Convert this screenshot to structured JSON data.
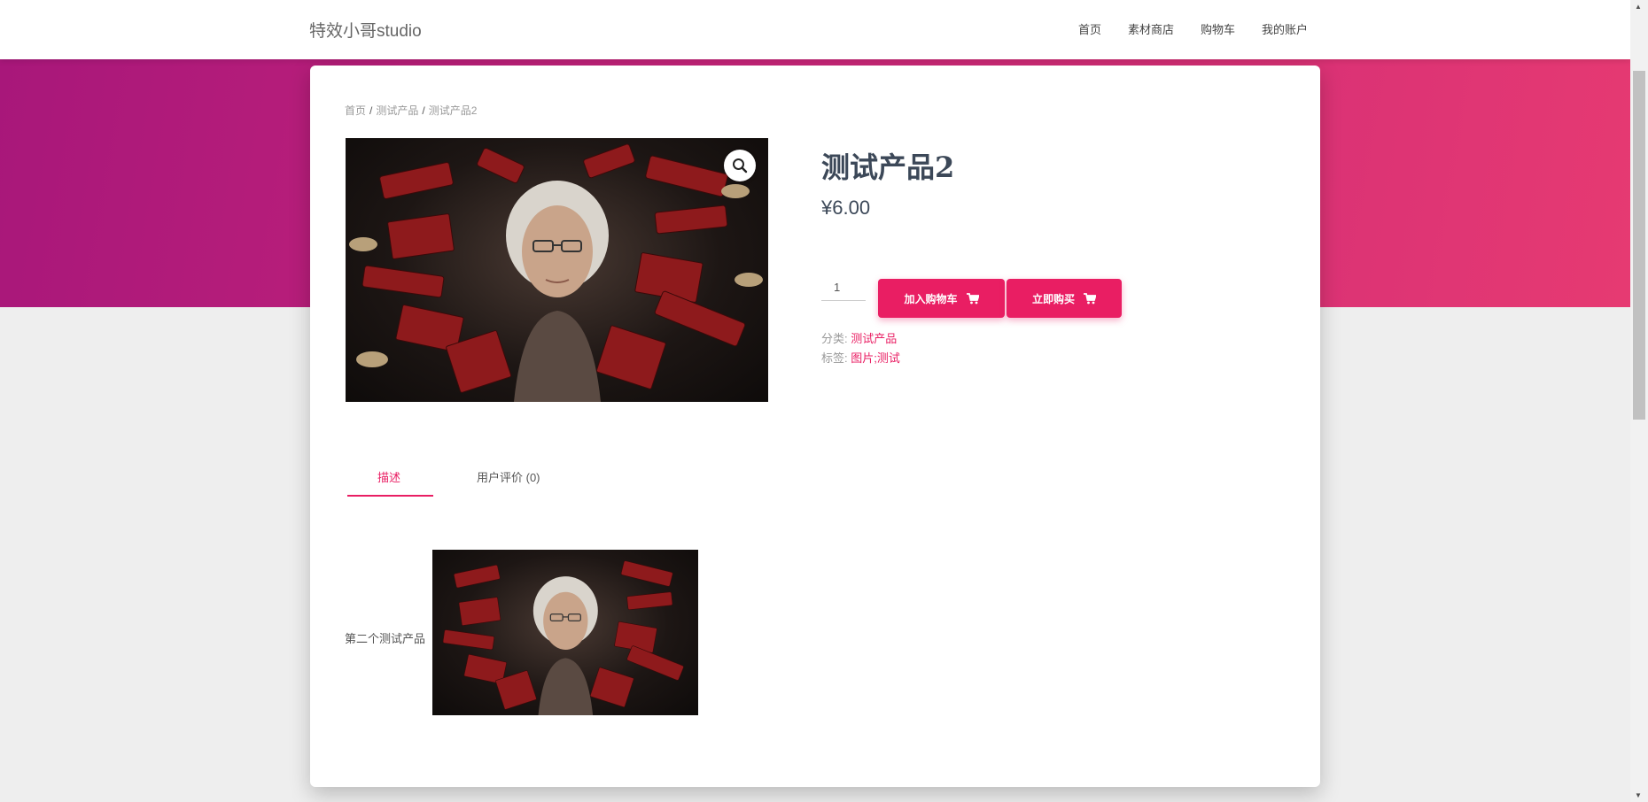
{
  "nav": {
    "brand": "特效小哥studio",
    "links": [
      "首页",
      "素材商店",
      "购物车",
      "我的账户"
    ]
  },
  "breadcrumb": {
    "items": [
      "首页",
      "测试产品",
      "测试产品2"
    ],
    "separator": "/"
  },
  "product": {
    "title": "测试产品2",
    "price": "¥6.00",
    "quantity": "1",
    "add_to_cart_label": "加入购物车",
    "buy_now_label": "立即购买",
    "category_label": "分类:",
    "category_value": "测试产品",
    "tags_label": "标签:",
    "tags_value": "图片;测试"
  },
  "tabs": {
    "description": "描述",
    "reviews": "用户评价 (0)"
  },
  "description": {
    "text": "第二个测试产品"
  },
  "colors": {
    "accent": "#e91e63",
    "hero_start": "#a8177a",
    "hero_end": "#e63a72",
    "title": "#3c4858"
  },
  "icons": [
    "zoom-icon",
    "cart-icon",
    "scroll-up-arrow-icon",
    "scroll-down-arrow-icon"
  ]
}
